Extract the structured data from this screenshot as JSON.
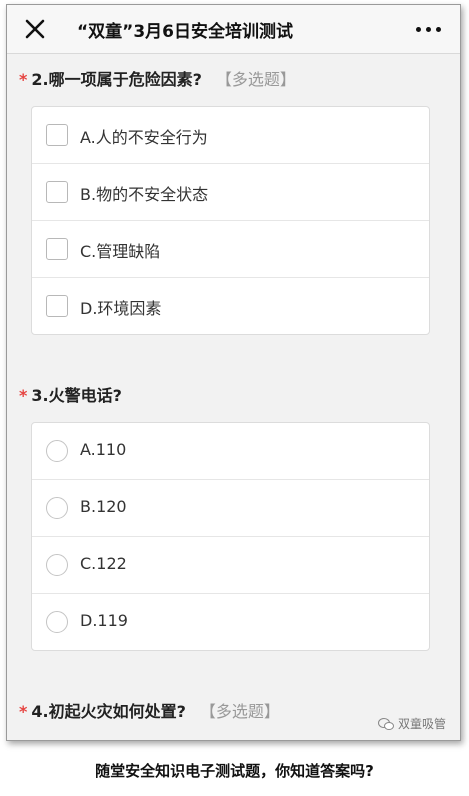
{
  "header": {
    "title": "“双童”3月6日安全培训测试"
  },
  "questions": [
    {
      "star": "*",
      "title": "2.哪一项属于危险因素?",
      "tag": "【多选题】",
      "options": [
        "A.人的不安全行为",
        "B.物的不安全状态",
        "C.管理缺陷",
        "D.环境因素"
      ]
    },
    {
      "star": "*",
      "title": "3.火警电话?",
      "options": [
        "A.110",
        "B.120",
        "C.122",
        "D.119"
      ]
    },
    {
      "star": "*",
      "title": "4.初起火灾如何处置?",
      "tag": "【多选题】"
    }
  ],
  "watermark": "双童吸管",
  "caption": "随堂安全知识电子测试题，你知道答案吗?"
}
